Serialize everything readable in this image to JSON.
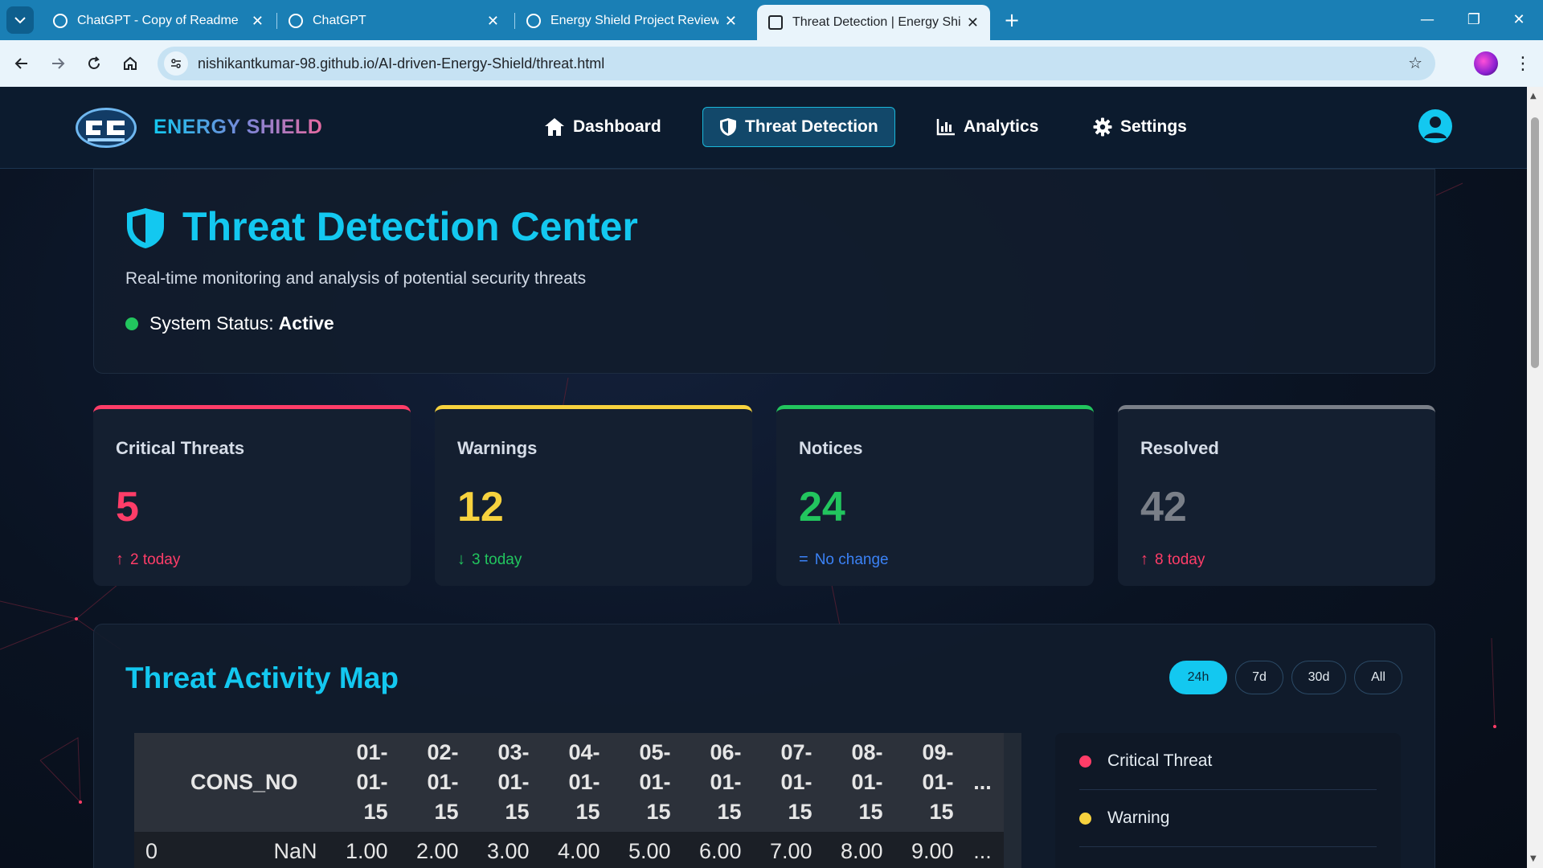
{
  "browser": {
    "tabs": [
      {
        "title": "ChatGPT - Copy of Readme"
      },
      {
        "title": "ChatGPT"
      },
      {
        "title": "Energy Shield Project Review"
      },
      {
        "title": "Threat Detection | Energy Shield"
      }
    ],
    "url": "nishikantkumar-98.github.io/AI-driven-Energy-Shield/threat.html"
  },
  "nav": {
    "brand": "ENERGY SHIELD",
    "links": [
      {
        "label": "Dashboard",
        "icon": "home-icon"
      },
      {
        "label": "Threat Detection",
        "icon": "shield-icon",
        "active": true
      },
      {
        "label": "Analytics",
        "icon": "chart-icon"
      },
      {
        "label": "Settings",
        "icon": "gear-icon"
      }
    ]
  },
  "hero": {
    "title": "Threat Detection Center",
    "subtitle": "Real-time monitoring and analysis of potential security threats",
    "status_label": "System Status:",
    "status_value": "Active",
    "status_color": "#22c55e"
  },
  "stats": [
    {
      "label": "Critical Threats",
      "value": "5",
      "delta": "2 today",
      "direction": "up",
      "color": "#ff3d68",
      "delta_color": "#ff3d68"
    },
    {
      "label": "Warnings",
      "value": "12",
      "delta": "3 today",
      "direction": "down",
      "color": "#f7d23e",
      "delta_color": "#22c55e"
    },
    {
      "label": "Notices",
      "value": "24",
      "delta": "No change",
      "direction": "flat",
      "color": "#22c55e",
      "delta_color": "#3b82f6"
    },
    {
      "label": "Resolved",
      "value": "42",
      "delta": "8 today",
      "direction": "up",
      "color": "#7a7f88",
      "delta_color": "#ff3d68"
    }
  ],
  "map": {
    "title": "Threat Activity Map",
    "ranges": [
      "24h",
      "7d",
      "30d",
      "All"
    ],
    "active_range": "24h",
    "table": {
      "index_header": "",
      "cons_header": "CONS_NO",
      "date_headers": [
        [
          "01-",
          "01-",
          "15"
        ],
        [
          "02-",
          "01-",
          "15"
        ],
        [
          "03-",
          "01-",
          "15"
        ],
        [
          "04-",
          "01-",
          "15"
        ],
        [
          "05-",
          "01-",
          "15"
        ],
        [
          "06-",
          "01-",
          "15"
        ],
        [
          "07-",
          "01-",
          "15"
        ],
        [
          "08-",
          "01-",
          "15"
        ],
        [
          "09-",
          "01-",
          "15"
        ]
      ],
      "ellipsis": "...",
      "rows": [
        {
          "index": "0",
          "cons": "NaN",
          "values": [
            "1.00",
            "2.00",
            "3.00",
            "4.00",
            "5.00",
            "6.00",
            "7.00",
            "8.00",
            "9.00"
          ],
          "ellipsis": "..."
        }
      ]
    },
    "legend": [
      {
        "label": "Critical Threat",
        "color": "#ff3d68"
      },
      {
        "label": "Warning",
        "color": "#f7d23e"
      }
    ]
  }
}
